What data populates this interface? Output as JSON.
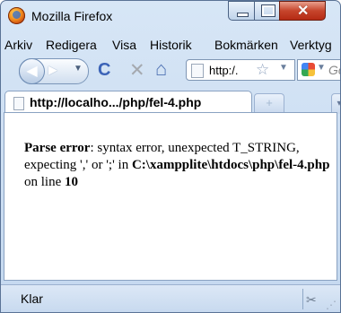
{
  "window": {
    "title": "Mozilla Firefox",
    "controls": {
      "minimize": "",
      "maximize": "",
      "close": "✕"
    }
  },
  "menu": [
    "Arkiv",
    "Redigera",
    "Visa",
    "Historik",
    "Bokmärken",
    "Verktyg"
  ],
  "toolbar": {
    "url_text": "http:/.",
    "search_placeholder": "Go"
  },
  "tabs": [
    {
      "label": "http://localho.../php/fel-4.php",
      "active": true
    }
  ],
  "content": {
    "error_label": "Parse error",
    "message_part1": ": syntax error, unexpected T_STRING, expecting ',' or ';' in ",
    "file_path": "C:\\xampplite\\htdocs\\php\\fel-4.php",
    "message_part2": " on line ",
    "line_number": "10"
  },
  "status": {
    "text": "Klar"
  },
  "colors": {
    "window_frame": "#5a7396",
    "chrome_background": "#d7e6f6",
    "close_button": "#c6452c"
  }
}
